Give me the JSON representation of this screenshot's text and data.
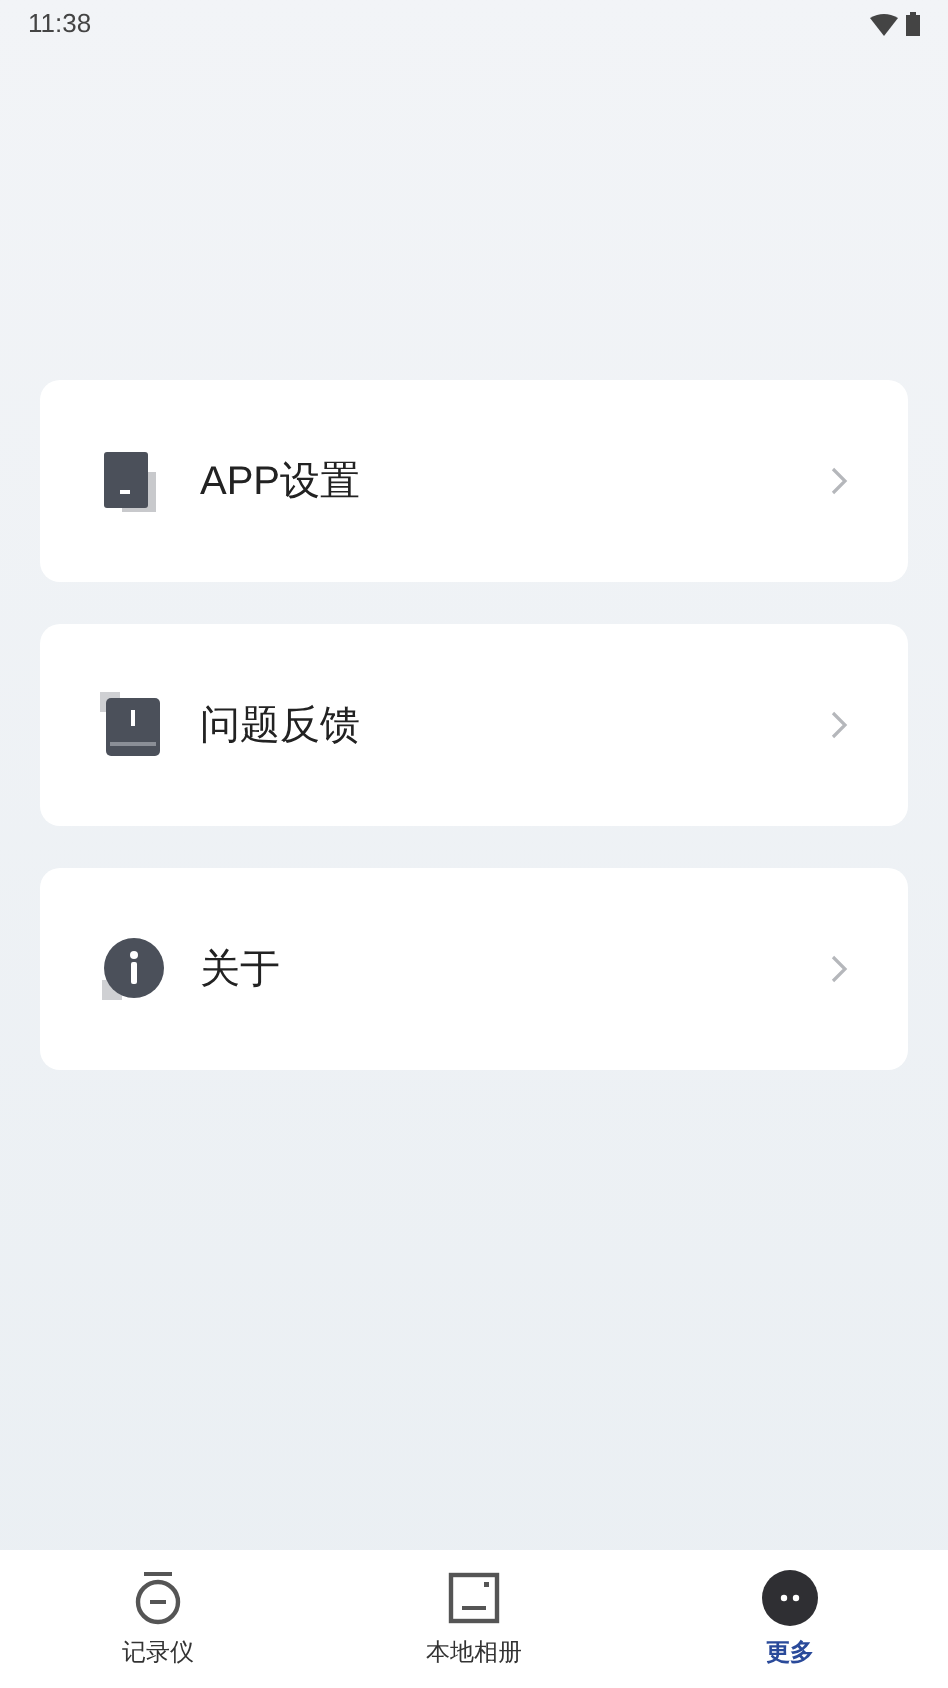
{
  "status_bar": {
    "time": "11:38"
  },
  "menu": [
    {
      "kind": "settings",
      "label": "APP设置"
    },
    {
      "kind": "feedback",
      "label": "问题反馈"
    },
    {
      "kind": "about",
      "label": "关于"
    }
  ],
  "bottom_nav": [
    {
      "kind": "recorder",
      "label": "记录仪",
      "selected": false
    },
    {
      "kind": "album",
      "label": "本地相册",
      "selected": false
    },
    {
      "kind": "more",
      "label": "更多",
      "selected": true
    }
  ]
}
